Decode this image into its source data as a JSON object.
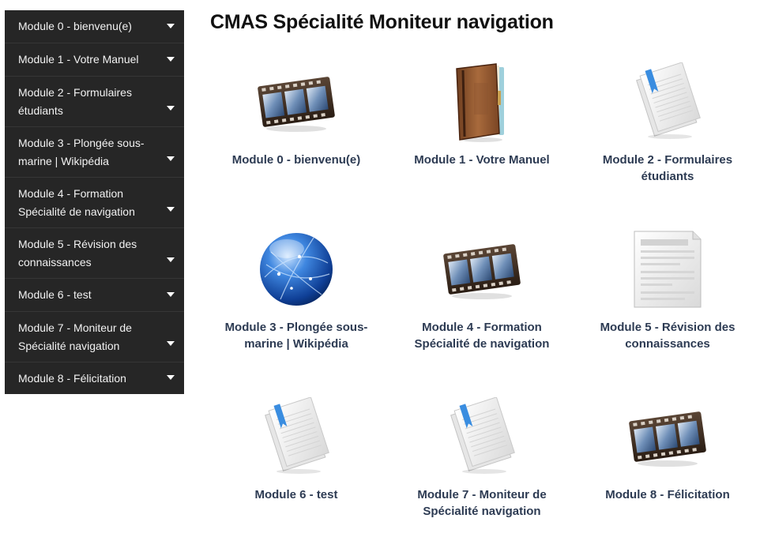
{
  "page": {
    "title": "CMAS Spécialité Moniteur navigation"
  },
  "sidebar": {
    "items": [
      {
        "label": "Module 0 - bienvenu(e)"
      },
      {
        "label": "Module 1 - Votre Manuel"
      },
      {
        "label": "Module 2 - Formulaires étudiants"
      },
      {
        "label": "Module 3 - Plongée sous-marine | Wikipédia"
      },
      {
        "label": "Module 4 - Formation Spécialité de navigation"
      },
      {
        "label": "Module 5 - Révision des connaissances"
      },
      {
        "label": "Module 6 - test"
      },
      {
        "label": "Module 7 - Moniteur de Spécialité navigation"
      },
      {
        "label": "Module 8 - Félicitation"
      }
    ]
  },
  "modules": [
    {
      "label": "Module 0 - bienvenu(e)",
      "icon": "film-strip-icon"
    },
    {
      "label": "Module 1 - Votre Manuel",
      "icon": "book-icon"
    },
    {
      "label": "Module 2 - Formulaires étudiants",
      "icon": "document-bookmark-icon"
    },
    {
      "label": "Module 3 - Plongée sous-marine | Wikipédia",
      "icon": "globe-icon"
    },
    {
      "label": "Module 4 - Formation Spécialité de navigation",
      "icon": "film-strip-icon"
    },
    {
      "label": "Module 5 - Révision des connaissances",
      "icon": "text-document-icon"
    },
    {
      "label": "Module 6 - test",
      "icon": "document-bookmark-icon"
    },
    {
      "label": "Module 7 - Moniteur de Spécialité navigation",
      "icon": "document-bookmark-icon"
    },
    {
      "label": "Module 8 - Félicitation",
      "icon": "film-strip-icon"
    }
  ]
}
